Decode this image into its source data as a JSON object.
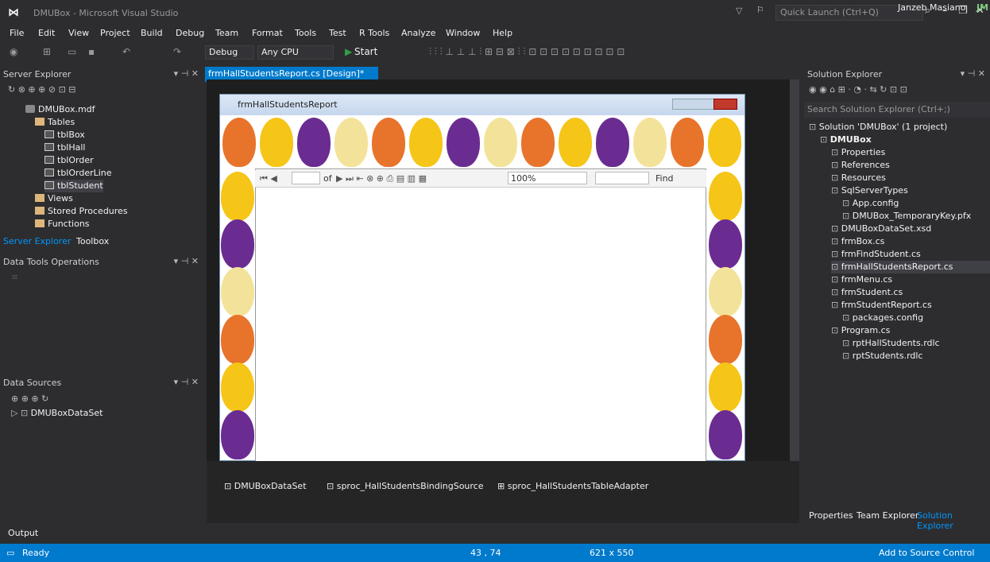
{
  "window": {
    "title": "DMUBox - Microsoft Visual Studio",
    "quick_launch_placeholder": "Quick Launch (Ctrl+Q)",
    "user": "Janzeb Masiano",
    "user_initials": "JM"
  },
  "menu": [
    "File",
    "Edit",
    "View",
    "Project",
    "Build",
    "Debug",
    "Team",
    "Format",
    "Tools",
    "Test",
    "R Tools",
    "Analyze",
    "Window",
    "Help"
  ],
  "toolbar": {
    "config": "Debug",
    "platform": "Any CPU",
    "start": "Start"
  },
  "server_explorer": {
    "title": "Server Explorer",
    "items": [
      {
        "label": "DMUBox.mdf",
        "indent": 1,
        "icon": "db"
      },
      {
        "label": "Tables",
        "indent": 2,
        "icon": "folder"
      },
      {
        "label": "tblBox",
        "indent": 3,
        "icon": "table"
      },
      {
        "label": "tblHall",
        "indent": 3,
        "icon": "table"
      },
      {
        "label": "tblOrder",
        "indent": 3,
        "icon": "table"
      },
      {
        "label": "tblOrderLine",
        "indent": 3,
        "icon": "table"
      },
      {
        "label": "tblStudent",
        "indent": 3,
        "icon": "table",
        "selected": true
      },
      {
        "label": "Views",
        "indent": 2,
        "icon": "folder"
      },
      {
        "label": "Stored Procedures",
        "indent": 2,
        "icon": "folder"
      },
      {
        "label": "Functions",
        "indent": 2,
        "icon": "folder"
      }
    ],
    "tabs": [
      "Server Explorer",
      "Toolbox"
    ]
  },
  "data_tools": {
    "title": "Data Tools Operations"
  },
  "data_sources": {
    "title": "Data Sources",
    "item": "DMUBoxDataSet"
  },
  "document_tab": {
    "label": "frmHallStudentsReport.cs [Design]*"
  },
  "form": {
    "title": "frmHallStudentsReport",
    "report_toolbar": {
      "of": "of",
      "zoom": "100%",
      "find": "Find"
    }
  },
  "components": [
    "DMUBoxDataSet",
    "sproc_HallStudentsBindingSource",
    "sproc_HallStudentsTableAdapter"
  ],
  "solution_explorer": {
    "title": "Solution Explorer",
    "search_placeholder": "Search Solution Explorer (Ctrl+;)",
    "items": [
      {
        "label": "Solution 'DMUBox' (1 project)",
        "indent": 0
      },
      {
        "label": "DMUBox",
        "indent": 1,
        "bold": true
      },
      {
        "label": "Properties",
        "indent": 2
      },
      {
        "label": "References",
        "indent": 2
      },
      {
        "label": "Resources",
        "indent": 2
      },
      {
        "label": "SqlServerTypes",
        "indent": 2
      },
      {
        "label": "App.config",
        "indent": 3
      },
      {
        "label": "DMUBox_TemporaryKey.pfx",
        "indent": 3
      },
      {
        "label": "DMUBoxDataSet.xsd",
        "indent": 2
      },
      {
        "label": "frmBox.cs",
        "indent": 2
      },
      {
        "label": "frmFindStudent.cs",
        "indent": 2
      },
      {
        "label": "frmHallStudentsReport.cs",
        "indent": 2,
        "selected": true
      },
      {
        "label": "frmMenu.cs",
        "indent": 2
      },
      {
        "label": "frmStudent.cs",
        "indent": 2
      },
      {
        "label": "frmStudentReport.cs",
        "indent": 2
      },
      {
        "label": "packages.config",
        "indent": 3
      },
      {
        "label": "Program.cs",
        "indent": 2
      },
      {
        "label": "rptHallStudents.rdlc",
        "indent": 3
      },
      {
        "label": "rptStudents.rdlc",
        "indent": 3
      }
    ],
    "tabs": [
      "Properties",
      "Team Explorer",
      "Solution Explorer"
    ]
  },
  "output": {
    "title": "Output"
  },
  "status": {
    "ready": "Ready",
    "position": "43 , 74",
    "size": "621 x 550",
    "source_control": "Add to Source Control"
  },
  "colors": {
    "accent": "#007acc",
    "selected": "#3f3f46",
    "veg": [
      "#e8732b",
      "#f5c518",
      "#6a2c91",
      "#f3e39a"
    ]
  }
}
